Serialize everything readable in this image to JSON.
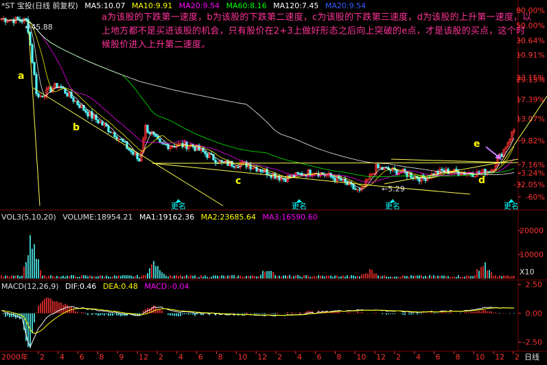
{
  "colors": {
    "background": "#000000",
    "up": "#ff3232",
    "down": "#54fcfc",
    "grid": "#7a0000",
    "axis_text": "#ff3232",
    "ma5": "#ffffff",
    "ma10": "#ffff00",
    "ma20": "#ff00ff",
    "ma60": "#00ff00",
    "ma120": "#ffffff",
    "ma20b": "#0000ff",
    "trendline": "#ffff55",
    "annotation": "#ff3399"
  },
  "price_header": {
    "title": "*ST 宝投(日线 前复权)",
    "ma5": "MA5:10.07",
    "ma10": "MA10:9.91",
    "ma20": "MA20:9.54",
    "ma60": "MA60:8.16",
    "ma120": "MA120:7.45",
    "ma20b": "MA20:9.54"
  },
  "annotation_text": "a为该股的下跌第一速度，b为该股的下跌第二速度，c为该股的下跌第三速度，d为该股的上升第一速度，以上地方都不是买进该股的机会，只有股价在2+3上做好形态之后向上突破的e点，才是该股的买点，这个时候股价进入上升第二速度。",
  "volume_header": {
    "title": "VOL3(5,10,20)",
    "volume": "VOLUME:18954.21",
    "ma1": "MA1:19162.36",
    "ma2": "MA2:23685.64",
    "ma3": "MA3:16590.60"
  },
  "macd_header": {
    "title": "MACD(12,26,9)",
    "dif": "DIF:0.46",
    "dea": "DEA:0.48",
    "macd": "MACD:-0.04"
  },
  "bottom_axis": {
    "start_label": "2000年",
    "right_label": "日线",
    "months": [
      "2",
      "4",
      "6",
      "8",
      "9",
      "12",
      "2",
      "4",
      "6",
      "8",
      "10",
      "12",
      "2",
      "4",
      "6",
      "8",
      "10",
      "12",
      "2",
      "4",
      "6",
      "8",
      "10",
      "12",
      "2"
    ]
  },
  "rename_labels": [
    "更名",
    "更名",
    "更名",
    "更名"
  ],
  "price_marks": {
    "high": "45.88",
    "low": "5.29"
  },
  "wave_labels": [
    "a",
    "b",
    "c",
    "d",
    "e"
  ],
  "chart_data": [
    {
      "type": "line",
      "panel": "price",
      "yscale": "log",
      "y_tick_labels": [
        "80.00%",
        "50.00%",
        "30.64%",
        "10.91%",
        "23.15%",
        "29.15%",
        "17.39%",
        "13.07%",
        "9.82%",
        "7.16%",
        "-3.24%",
        "-32.05%",
        "-60%"
      ],
      "high": 45.88,
      "low": 5.29,
      "close_path_x": [
        0,
        0.05,
        0.07,
        0.11,
        0.17,
        0.22,
        0.27,
        0.28,
        0.31,
        0.37,
        0.43,
        0.48,
        0.55,
        0.61,
        0.66,
        0.7,
        0.73,
        0.78,
        0.82,
        0.86,
        0.9,
        0.93,
        0.955,
        0.975,
        1.0
      ],
      "close_path_y": [
        45,
        44,
        17,
        20,
        14,
        11,
        7.8,
        12,
        9.5,
        9.5,
        7.6,
        7.5,
        6.3,
        6.9,
        6.2,
        5.3,
        7.2,
        6.8,
        6.3,
        6.9,
        6.8,
        6.7,
        7,
        8.5,
        11.5
      ]
    },
    {
      "type": "bar",
      "panel": "volume",
      "y_tick_labels": [
        "20000",
        "10000",
        "X10"
      ],
      "ylim": [
        0,
        24000
      ],
      "peaks_x": [
        0.06,
        0.3,
        0.52,
        0.72,
        0.94
      ],
      "peaks_v": [
        22000,
        8000,
        4000,
        3500,
        7000
      ]
    },
    {
      "type": "line",
      "panel": "macd",
      "y_tick_labels": [
        "2.50",
        "0.00",
        "-2.50"
      ],
      "ylim": [
        -3.3,
        2.0
      ],
      "dif_x": [
        0,
        0.04,
        0.055,
        0.07,
        0.09,
        0.13,
        0.2,
        0.27,
        0.3,
        0.35,
        0.45,
        0.55,
        0.65,
        0.72,
        0.8,
        0.9,
        0.95,
        1.0
      ],
      "dif_y": [
        0.2,
        -0.4,
        -3.0,
        -1.5,
        -0.3,
        0.6,
        0.2,
        -0.2,
        0.6,
        0.1,
        -0.1,
        -0.2,
        0.2,
        0.3,
        0.1,
        0.2,
        0.5,
        0.46
      ]
    }
  ]
}
